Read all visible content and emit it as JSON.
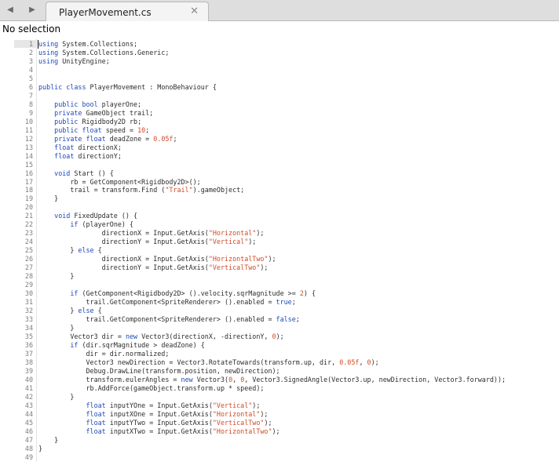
{
  "tab": {
    "title": "PlayerMovement.cs"
  },
  "status": {
    "text": "No selection"
  },
  "code_lines": [
    [
      {
        "t": "kw",
        "v": "using"
      },
      {
        "t": "",
        "v": " System.Collections;"
      }
    ],
    [
      {
        "t": "kw",
        "v": "using"
      },
      {
        "t": "",
        "v": " System.Collections.Generic;"
      }
    ],
    [
      {
        "t": "kw",
        "v": "using"
      },
      {
        "t": "",
        "v": " UnityEngine;"
      }
    ],
    [],
    [],
    [
      {
        "t": "kw",
        "v": "public class"
      },
      {
        "t": "",
        "v": " PlayerMovement : MonoBehaviour {"
      }
    ],
    [],
    [
      {
        "t": "",
        "v": "    "
      },
      {
        "t": "kw",
        "v": "public bool"
      },
      {
        "t": "",
        "v": " playerOne;"
      }
    ],
    [
      {
        "t": "",
        "v": "    "
      },
      {
        "t": "kw",
        "v": "private"
      },
      {
        "t": "",
        "v": " GameObject trail;"
      }
    ],
    [
      {
        "t": "",
        "v": "    "
      },
      {
        "t": "kw",
        "v": "public"
      },
      {
        "t": "",
        "v": " Rigidbody2D rb;"
      }
    ],
    [
      {
        "t": "",
        "v": "    "
      },
      {
        "t": "kw",
        "v": "public float"
      },
      {
        "t": "",
        "v": " speed = "
      },
      {
        "t": "num",
        "v": "10"
      },
      {
        "t": "",
        "v": ";"
      }
    ],
    [
      {
        "t": "",
        "v": "    "
      },
      {
        "t": "kw",
        "v": "private float"
      },
      {
        "t": "",
        "v": " deadZone = "
      },
      {
        "t": "num",
        "v": "0.05f"
      },
      {
        "t": "",
        "v": ";"
      }
    ],
    [
      {
        "t": "",
        "v": "    "
      },
      {
        "t": "kw",
        "v": "float"
      },
      {
        "t": "",
        "v": " directionX;"
      }
    ],
    [
      {
        "t": "",
        "v": "    "
      },
      {
        "t": "kw",
        "v": "float"
      },
      {
        "t": "",
        "v": " directionY;"
      }
    ],
    [],
    [
      {
        "t": "",
        "v": "    "
      },
      {
        "t": "kw",
        "v": "void"
      },
      {
        "t": "",
        "v": " Start () {"
      }
    ],
    [
      {
        "t": "",
        "v": "        rb = GetComponent<Rigidbody2D>();"
      }
    ],
    [
      {
        "t": "",
        "v": "        trail = transform.Find ("
      },
      {
        "t": "str",
        "v": "\"Trail\""
      },
      {
        "t": "",
        "v": ").gameObject;"
      }
    ],
    [
      {
        "t": "",
        "v": "    }"
      }
    ],
    [],
    [
      {
        "t": "",
        "v": "    "
      },
      {
        "t": "kw",
        "v": "void"
      },
      {
        "t": "",
        "v": " FixedUpdate () {"
      }
    ],
    [
      {
        "t": "",
        "v": "        "
      },
      {
        "t": "kw",
        "v": "if"
      },
      {
        "t": "",
        "v": " (playerOne) {"
      }
    ],
    [
      {
        "t": "",
        "v": "                directionX = Input.GetAxis("
      },
      {
        "t": "str",
        "v": "\"Horizontal\""
      },
      {
        "t": "",
        "v": ");"
      }
    ],
    [
      {
        "t": "",
        "v": "                directionY = Input.GetAxis("
      },
      {
        "t": "str",
        "v": "\"Vertical\""
      },
      {
        "t": "",
        "v": ");"
      }
    ],
    [
      {
        "t": "",
        "v": "        } "
      },
      {
        "t": "kw",
        "v": "else"
      },
      {
        "t": "",
        "v": " {"
      }
    ],
    [
      {
        "t": "",
        "v": "                directionX = Input.GetAxis("
      },
      {
        "t": "str",
        "v": "\"HorizontalTwo\""
      },
      {
        "t": "",
        "v": ");"
      }
    ],
    [
      {
        "t": "",
        "v": "                directionY = Input.GetAxis("
      },
      {
        "t": "str",
        "v": "\"VerticalTwo\""
      },
      {
        "t": "",
        "v": ");"
      }
    ],
    [
      {
        "t": "",
        "v": "        }"
      }
    ],
    [],
    [
      {
        "t": "",
        "v": "        "
      },
      {
        "t": "kw",
        "v": "if"
      },
      {
        "t": "",
        "v": " (GetComponent<Rigidbody2D> ().velocity.sqrMagnitude >= "
      },
      {
        "t": "num",
        "v": "2"
      },
      {
        "t": "",
        "v": ") {"
      }
    ],
    [
      {
        "t": "",
        "v": "            trail.GetComponent<SpriteRenderer> ().enabled = "
      },
      {
        "t": "kw",
        "v": "true"
      },
      {
        "t": "",
        "v": ";"
      }
    ],
    [
      {
        "t": "",
        "v": "        } "
      },
      {
        "t": "kw",
        "v": "else"
      },
      {
        "t": "",
        "v": " {"
      }
    ],
    [
      {
        "t": "",
        "v": "            trail.GetComponent<SpriteRenderer> ().enabled = "
      },
      {
        "t": "kw",
        "v": "false"
      },
      {
        "t": "",
        "v": ";"
      }
    ],
    [
      {
        "t": "",
        "v": "        }"
      }
    ],
    [
      {
        "t": "",
        "v": "        Vector3 dir = "
      },
      {
        "t": "kw",
        "v": "new"
      },
      {
        "t": "",
        "v": " Vector3(directionX, -directionY, "
      },
      {
        "t": "num",
        "v": "0"
      },
      {
        "t": "",
        "v": ");"
      }
    ],
    [
      {
        "t": "",
        "v": "        "
      },
      {
        "t": "kw",
        "v": "if"
      },
      {
        "t": "",
        "v": " (dir.sqrMagnitude > deadZone) {"
      }
    ],
    [
      {
        "t": "",
        "v": "            dir = dir.normalized;"
      }
    ],
    [
      {
        "t": "",
        "v": "            Vector3 newDirection = Vector3.RotateTowards(transform.up, dir, "
      },
      {
        "t": "num",
        "v": "0.05f"
      },
      {
        "t": "",
        "v": ", "
      },
      {
        "t": "num",
        "v": "0"
      },
      {
        "t": "",
        "v": ");"
      }
    ],
    [
      {
        "t": "",
        "v": "            Debug.DrawLine(transform.position, newDirection);"
      }
    ],
    [
      {
        "t": "",
        "v": "            transform.eulerAngles = "
      },
      {
        "t": "kw",
        "v": "new"
      },
      {
        "t": "",
        "v": " Vector3("
      },
      {
        "t": "num",
        "v": "0"
      },
      {
        "t": "",
        "v": ", "
      },
      {
        "t": "num",
        "v": "0"
      },
      {
        "t": "",
        "v": ", Vector3.SignedAngle(Vector3.up, newDirection, Vector3.forward));"
      }
    ],
    [
      {
        "t": "",
        "v": "            rb.AddForce(gameObject.transform.up * speed);"
      }
    ],
    [
      {
        "t": "",
        "v": "        }"
      }
    ],
    [
      {
        "t": "",
        "v": "            "
      },
      {
        "t": "kw",
        "v": "float"
      },
      {
        "t": "",
        "v": " inputYOne = Input.GetAxis("
      },
      {
        "t": "str",
        "v": "\"Vertical\""
      },
      {
        "t": "",
        "v": ");"
      }
    ],
    [
      {
        "t": "",
        "v": "            "
      },
      {
        "t": "kw",
        "v": "float"
      },
      {
        "t": "",
        "v": " inputXOne = Input.GetAxis("
      },
      {
        "t": "str",
        "v": "\"Horizontal\""
      },
      {
        "t": "",
        "v": ");"
      }
    ],
    [
      {
        "t": "",
        "v": "            "
      },
      {
        "t": "kw",
        "v": "float"
      },
      {
        "t": "",
        "v": " inputYTwo = Input.GetAxis("
      },
      {
        "t": "str",
        "v": "\"VerticalTwo\""
      },
      {
        "t": "",
        "v": ");"
      }
    ],
    [
      {
        "t": "",
        "v": "            "
      },
      {
        "t": "kw",
        "v": "float"
      },
      {
        "t": "",
        "v": " inputXTwo = Input.GetAxis("
      },
      {
        "t": "str",
        "v": "\"HorizontalTwo\""
      },
      {
        "t": "",
        "v": ");"
      }
    ],
    [
      {
        "t": "",
        "v": "    }"
      }
    ],
    [
      {
        "t": "",
        "v": "}"
      }
    ],
    []
  ],
  "icons": {
    "back": "chevron-left-icon",
    "forward": "chevron-right-icon",
    "close": "close-icon"
  }
}
